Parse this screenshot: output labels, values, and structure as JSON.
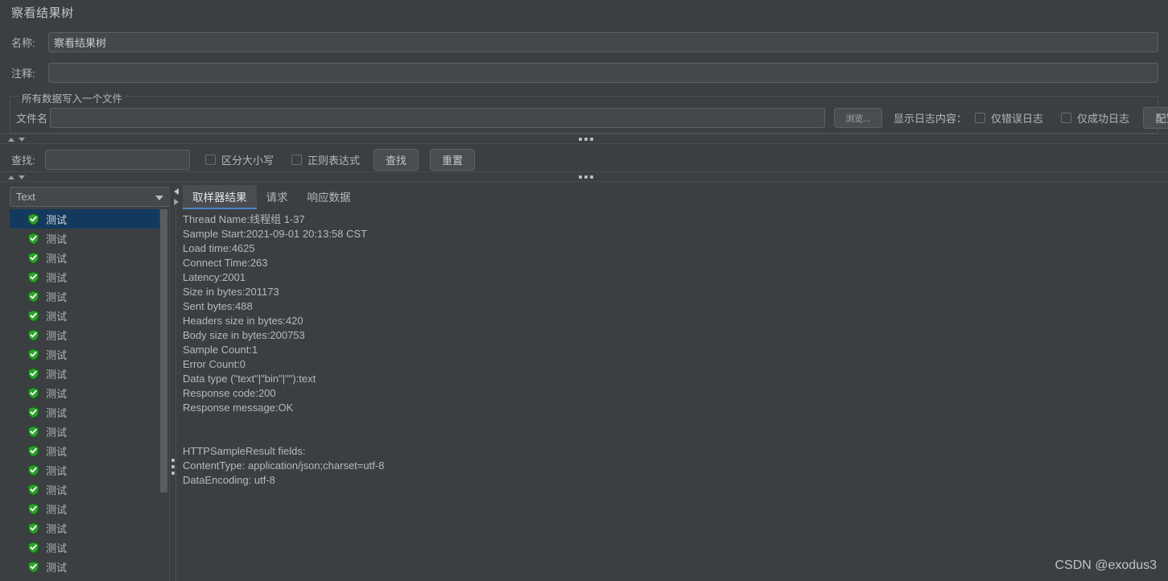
{
  "panel": {
    "title": "察看结果树"
  },
  "fields": {
    "name_label": "名称:",
    "name_value": "察看结果树",
    "comment_label": "注释:",
    "comment_value": ""
  },
  "file_group": {
    "legend": "所有数据写入一个文件",
    "filename_label": "文件名",
    "filename_value": "",
    "browse_button": "浏览...",
    "log_display_label": "显示日志内容：",
    "errors_only_checkbox": "仅错误日志",
    "errors_only_checked": false,
    "success_only_checkbox": "仅成功日志",
    "success_only_checked": false,
    "configure_button": "配置"
  },
  "search_bar": {
    "search_label": "查找:",
    "search_value": "",
    "case_sensitive_checkbox": "区分大小写",
    "case_sensitive_checked": false,
    "regex_checkbox": "正则表达式",
    "regex_checked": false,
    "search_button": "查找",
    "reset_button": "重置"
  },
  "left_panel": {
    "renderer_selected": "Text",
    "tree_items": [
      {
        "label": "测试",
        "status": "success",
        "selected": true
      },
      {
        "label": "测试",
        "status": "success",
        "selected": false
      },
      {
        "label": "测试",
        "status": "success",
        "selected": false
      },
      {
        "label": "测试",
        "status": "success",
        "selected": false
      },
      {
        "label": "测试",
        "status": "success",
        "selected": false
      },
      {
        "label": "测试",
        "status": "success",
        "selected": false
      },
      {
        "label": "测试",
        "status": "success",
        "selected": false
      },
      {
        "label": "测试",
        "status": "success",
        "selected": false
      },
      {
        "label": "测试",
        "status": "success",
        "selected": false
      },
      {
        "label": "测试",
        "status": "success",
        "selected": false
      },
      {
        "label": "测试",
        "status": "success",
        "selected": false
      },
      {
        "label": "测试",
        "status": "success",
        "selected": false
      },
      {
        "label": "测试",
        "status": "success",
        "selected": false
      },
      {
        "label": "测试",
        "status": "success",
        "selected": false
      },
      {
        "label": "测试",
        "status": "success",
        "selected": false
      },
      {
        "label": "测试",
        "status": "success",
        "selected": false
      },
      {
        "label": "测试",
        "status": "success",
        "selected": false
      },
      {
        "label": "测试",
        "status": "success",
        "selected": false
      },
      {
        "label": "测试",
        "status": "success",
        "selected": false
      }
    ]
  },
  "tabs": [
    {
      "label": "取样器结果",
      "active": true
    },
    {
      "label": "请求",
      "active": false
    },
    {
      "label": "响应数据",
      "active": false
    }
  ],
  "sampler_result": {
    "lines": [
      "Thread Name:线程组 1-37",
      "Sample Start:2021-09-01 20:13:58 CST",
      "Load time:4625",
      "Connect Time:263",
      "Latency:2001",
      "Size in bytes:201173",
      "Sent bytes:488",
      "Headers size in bytes:420",
      "Body size in bytes:200753",
      "Sample Count:1",
      "Error Count:0",
      "Data type (\"text\"|\"bin\"|\"\"):text",
      "Response code:200",
      "Response message:OK",
      "",
      "",
      "HTTPSampleResult fields:",
      "ContentType: application/json;charset=utf-8",
      "DataEncoding: utf-8"
    ]
  },
  "watermark": {
    "text": "CSDN @exodus3"
  },
  "colors": {
    "background": "#3c3f41",
    "field_background": "#45484a",
    "selection": "#133a5e",
    "tab_accent": "#4a88c7",
    "status_success": "#2f9e2f",
    "text": "#b6b8ba"
  }
}
